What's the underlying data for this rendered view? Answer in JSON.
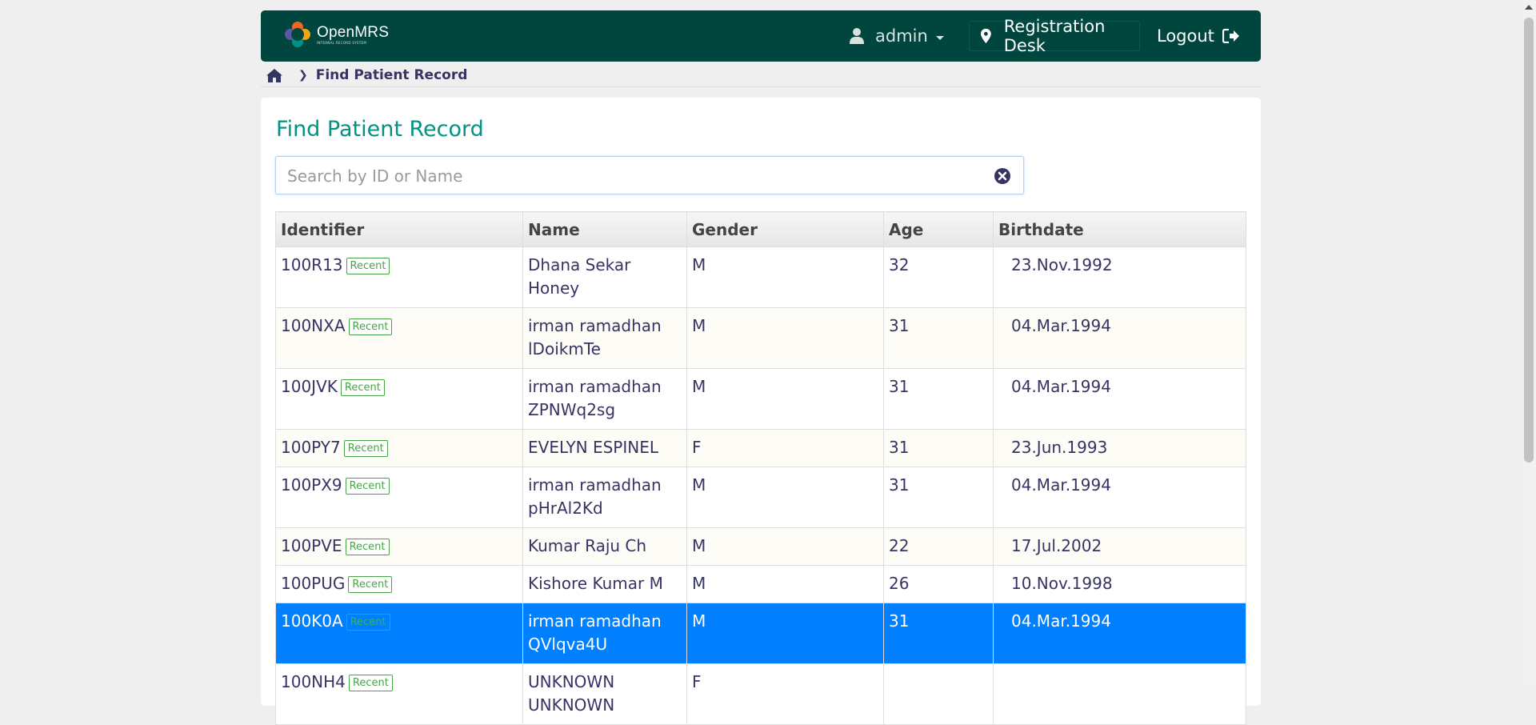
{
  "header": {
    "logo_name": "OpenMRS",
    "logo_sub": "INTERNAL RECORD SYSTEM",
    "user": "admin",
    "location": "Registration Desk",
    "logout": "Logout",
    "colors": {
      "bar": "#00463f",
      "title": "#009384",
      "selected_row": "#007fff",
      "badge": "#4aa349"
    }
  },
  "breadcrumb": {
    "home_icon": "home-icon",
    "current": "Find Patient Record"
  },
  "page": {
    "title": "Find Patient Record"
  },
  "search": {
    "placeholder": "Search by ID or Name",
    "value": ""
  },
  "table": {
    "columns": [
      "Identifier",
      "Name",
      "Gender",
      "Age",
      "Birthdate"
    ],
    "badge": "Recent",
    "rows": [
      {
        "id": "100R13",
        "name": "Dhana Sekar Honey",
        "gender": "M",
        "age": "32",
        "birthdate": "23.Nov.1992"
      },
      {
        "id": "100NXA",
        "name": "irman ramadhan lDoikmTe",
        "gender": "M",
        "age": "31",
        "birthdate": "04.Mar.1994"
      },
      {
        "id": "100JVK",
        "name": "irman ramadhan ZPNWq2sg",
        "gender": "M",
        "age": "31",
        "birthdate": "04.Mar.1994"
      },
      {
        "id": "100PY7",
        "name": "EVELYN ESPINEL",
        "gender": "F",
        "age": "31",
        "birthdate": "23.Jun.1993"
      },
      {
        "id": "100PX9",
        "name": "irman ramadhan pHrAl2Kd",
        "gender": "M",
        "age": "31",
        "birthdate": "04.Mar.1994"
      },
      {
        "id": "100PVE",
        "name": "Kumar Raju Ch",
        "gender": "M",
        "age": "22",
        "birthdate": "17.Jul.2002"
      },
      {
        "id": "100PUG",
        "name": "Kishore Kumar M",
        "gender": "M",
        "age": "26",
        "birthdate": "10.Nov.1998"
      },
      {
        "id": "100K0A",
        "name": "irman ramadhan QVlqva4U",
        "gender": "M",
        "age": "31",
        "birthdate": "04.Mar.1994"
      },
      {
        "id": "100NH4",
        "name": "UNKNOWN UNKNOWN",
        "gender": "F",
        "age": "",
        "birthdate": ""
      }
    ],
    "selected_id": "100K0A"
  }
}
